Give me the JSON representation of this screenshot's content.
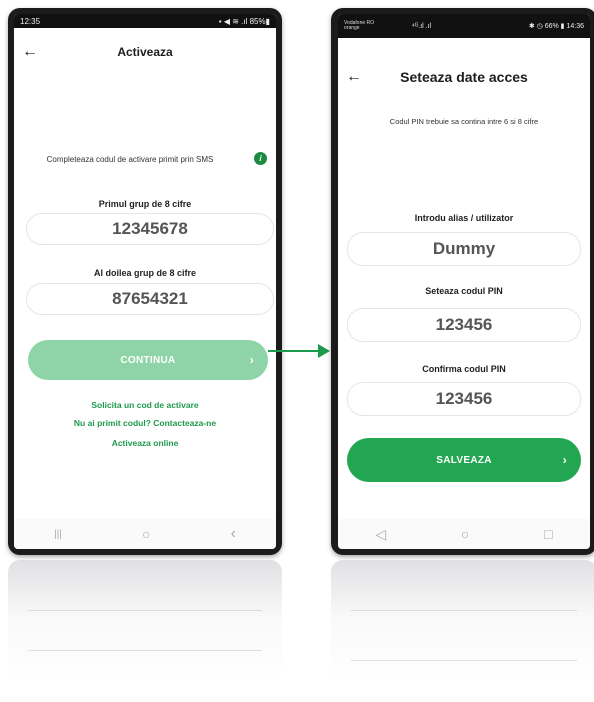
{
  "screen1": {
    "status": {
      "time": "12:35",
      "icons": "▪ ◀ ≋ .ıl 85%▮"
    },
    "header": {
      "title": "Activeaza"
    },
    "instruction": "Completeaza codul de activare primit prin SMS",
    "info_icon": "info-icon",
    "group1": {
      "label": "Primul grup de 8 cifre",
      "value": "12345678"
    },
    "group2": {
      "label": "Al doilea grup de 8 cifre",
      "value": "87654321"
    },
    "continue_button": {
      "label": "CONTINUA",
      "chevron": "›"
    },
    "links": [
      "Solicita un cod de activare",
      "Nu ai primit codul? Contacteaza-ne",
      "Activeaza online"
    ],
    "nav": {
      "recents": "|||",
      "home": "○",
      "back": "‹"
    }
  },
  "screen2": {
    "status": {
      "carrier": "Vodafone RO",
      "carrier2": "orange",
      "signal": "⁴ᴳ.ıl .ıl",
      "right": "✱ ◷ 66% ▮ 14:36"
    },
    "header": {
      "title": "Seteaza date acces"
    },
    "pin_rule": "Codul PIN trebuie sa contina intre 6 si 8 cifre",
    "alias": {
      "label": "Introdu alias / utilizator",
      "value": "Dummy"
    },
    "pin": {
      "label": "Seteaza codul PIN",
      "value": "123456"
    },
    "pin_confirm": {
      "label": "Confirma codul PIN",
      "value": "123456"
    },
    "save_button": {
      "label": "SALVEAZA",
      "chevron": "›"
    },
    "nav": {
      "back": "◁",
      "home": "○",
      "recents": "□"
    }
  },
  "colors": {
    "accent": "#1e9a4d",
    "button_disabled": "#8fd4a8",
    "button_active": "#22a652",
    "frame": "#1b1b1b"
  }
}
